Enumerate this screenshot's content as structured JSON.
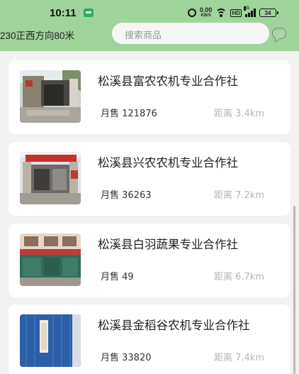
{
  "status_bar": {
    "time": "10:11",
    "net_speed_value": "0.00",
    "net_speed_unit": "KB/S",
    "network_type": "HD",
    "signal_label": "4G",
    "battery": "34"
  },
  "header": {
    "location": "230正西方向80米",
    "search_placeholder": "搜索商品"
  },
  "colors": {
    "header_bg": "#9fd49b",
    "page_bg": "#f2f2f2"
  },
  "cooperatives": [
    {
      "name": "松溪县富农农机专业合作社",
      "sales": "月售 121876",
      "distance": "距离 3.4km"
    },
    {
      "name": "松溪县兴农农机专业合作社",
      "sales": "月售 36263",
      "distance": "距离 7.2km"
    },
    {
      "name": "松溪县白羽蔬果专业合作社",
      "sales": "月售 49",
      "distance": "距离 6.7km"
    },
    {
      "name": "松溪县金稻谷农机专业合作社",
      "sales": "月售 33820",
      "distance": "距离 7.4km"
    }
  ]
}
